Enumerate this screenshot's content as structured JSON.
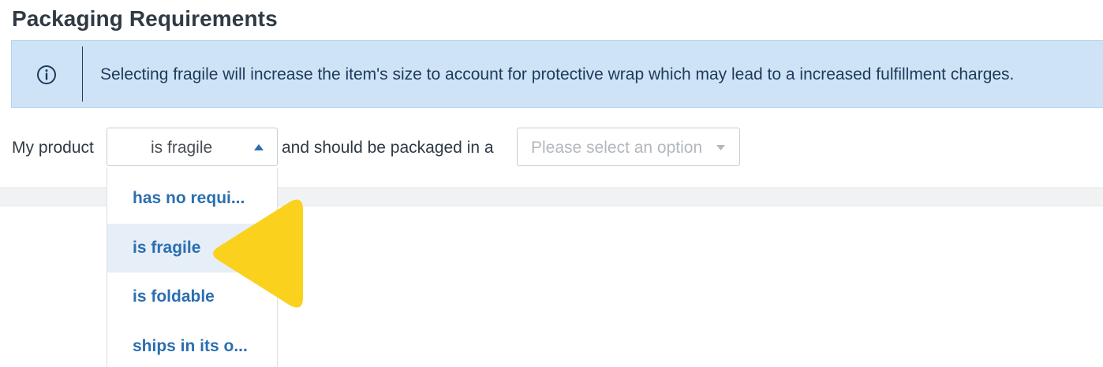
{
  "section": {
    "title": "Packaging Requirements"
  },
  "banner": {
    "icon": "info-icon",
    "message": "Selecting fragile will increase the item's size to account for protective wrap which may lead to a increased fulfillment charges."
  },
  "sentence": {
    "prefix": "My product",
    "middle": "and should be packaged in a"
  },
  "product_select": {
    "value": "is fragile",
    "expanded": true,
    "options": [
      {
        "label": "has no requi..."
      },
      {
        "label": "is fragile",
        "selected": true
      },
      {
        "label": "is foldable"
      },
      {
        "label": "ships in its o..."
      }
    ]
  },
  "package_select": {
    "placeholder": "Please select an option"
  },
  "colors": {
    "banner_bg": "#cfe3f7",
    "option_text": "#2a6fb0",
    "pointer": "#fad21d"
  }
}
